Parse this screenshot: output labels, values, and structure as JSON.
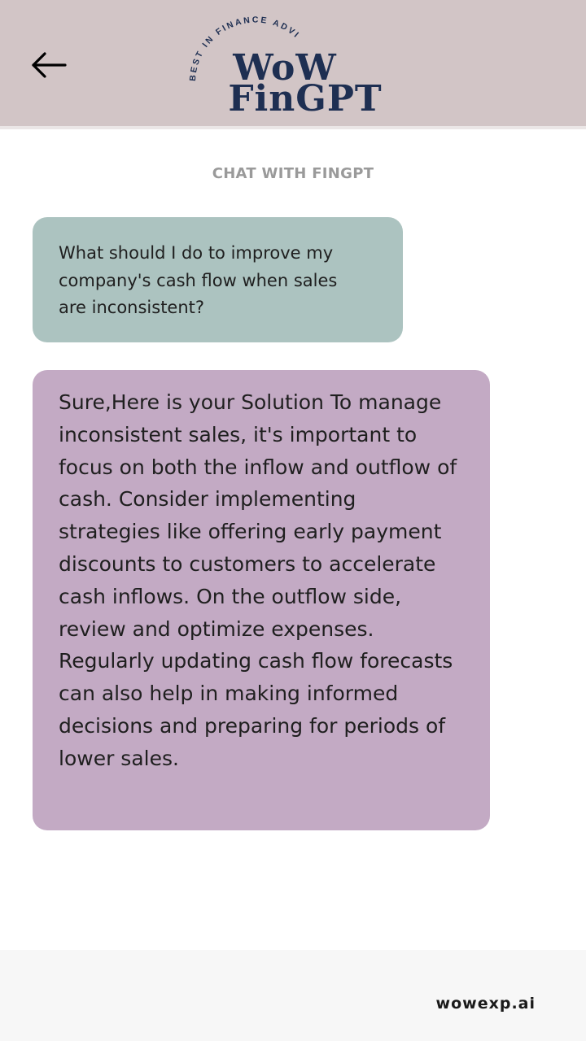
{
  "header": {
    "logo": {
      "arc_text": "BEST IN FINANCE ADVISORY",
      "line1": "WoW",
      "line2": "FinGPT",
      "color": "#1e2f52"
    },
    "background": "#d2c5c6",
    "back_icon": "arrow-left-icon"
  },
  "chat": {
    "title": "CHAT WITH FINGPT",
    "messages": [
      {
        "role": "user",
        "text": "What should I do to improve my company's cash flow when sales are inconsistent?",
        "color": "#acc3c0"
      },
      {
        "role": "assistant",
        "text": "Sure,Here is your Solution To manage inconsistent sales, it's important to focus on both the inflow and outflow of cash. Consider implementing strategies like offering early payment discounts to customers to accelerate cash inflows. On the outflow side, review and optimize expenses. Regularly updating cash flow forecasts can also help in making informed decisions and preparing for periods of lower sales.",
        "color": "#c3aac4"
      }
    ]
  },
  "footer": {
    "brand": "wowexp.ai"
  }
}
